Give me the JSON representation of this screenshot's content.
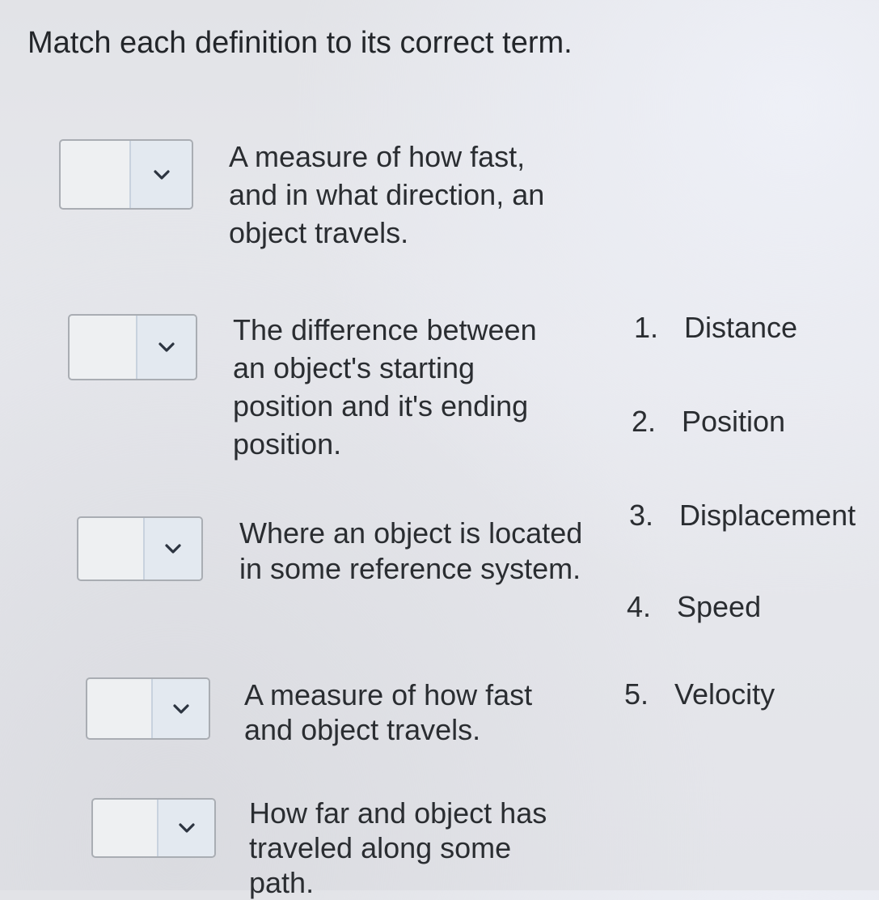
{
  "instructions": "Match each definition to its correct term.",
  "definitions": [
    {
      "text": "A measure of how fast, and in what direction, an object travels.",
      "selected": ""
    },
    {
      "text": "The difference between an object's starting position and it's ending position.",
      "selected": ""
    },
    {
      "text": "Where an object is located in some reference system.",
      "selected": ""
    },
    {
      "text": "A measure of how fast and object travels.",
      "selected": ""
    },
    {
      "text": "How far and object has traveled along some path.",
      "selected": ""
    }
  ],
  "terms": [
    {
      "number": "1.",
      "label": "Distance"
    },
    {
      "number": "2.",
      "label": "Position"
    },
    {
      "number": "3.",
      "label": "Displacement"
    },
    {
      "number": "4.",
      "label": "Speed"
    },
    {
      "number": "5.",
      "label": "Velocity"
    }
  ],
  "icons": {
    "dropdown": "chevron-down-icon"
  },
  "colors": {
    "chevron": "#2c3440",
    "dropdown_border": "#a9adb3"
  }
}
